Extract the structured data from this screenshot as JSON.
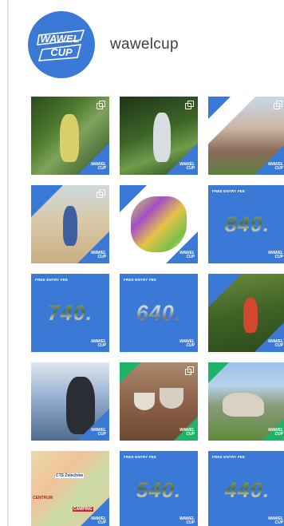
{
  "profile": {
    "username": "wawelcup",
    "logo_text_line1": "WAWEL",
    "logo_text_line2": "CUP"
  },
  "colors": {
    "brand_blue": "#3a79d6",
    "accent_green": "#1fb36a",
    "username_text": "#3f3f3f"
  },
  "icons": {
    "multi_post": "multiple-photos-icon"
  },
  "posts": [
    {
      "type": "photo",
      "multi": true
    },
    {
      "type": "photo",
      "multi": true
    },
    {
      "type": "photo",
      "multi": true
    },
    {
      "type": "photo",
      "multi": true
    },
    {
      "type": "photo",
      "multi": true
    },
    {
      "type": "graphic",
      "caption": "FREE ENTRY FEE",
      "number": "840."
    },
    {
      "type": "graphic",
      "caption": "FREE ENTRY FEE",
      "number": "740."
    },
    {
      "type": "graphic",
      "caption": "FREE ENTRY FEE",
      "number": "640."
    },
    {
      "type": "photo",
      "multi": false
    },
    {
      "type": "photo",
      "multi": false
    },
    {
      "type": "photo",
      "multi": true
    },
    {
      "type": "photo",
      "multi": false
    },
    {
      "type": "photo",
      "multi": false,
      "map_labels": [
        "CTS Żelechów",
        "CENTRUM",
        "CAMPING"
      ]
    },
    {
      "type": "graphic",
      "caption": "FREE ENTRY FEE",
      "number": "540."
    },
    {
      "type": "graphic",
      "caption": "FREE ENTRY FEE",
      "number": "440."
    }
  ],
  "watermark": {
    "line1": "WAWEL",
    "line2": "CUP"
  }
}
